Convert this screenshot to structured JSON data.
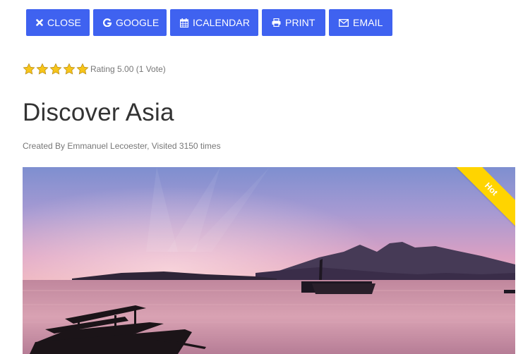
{
  "toolbar": {
    "close_label": "CLOSE",
    "google_label": "GOOGLE",
    "icalendar_label": "ICALENDAR",
    "print_label": "PRINT",
    "email_label": "EMAIL",
    "button_color": "#3f62f0"
  },
  "rating": {
    "stars_filled": 5,
    "stars_total": 5,
    "text": "Rating 5.00 (1 Vote)",
    "star_color": "#f7c51a"
  },
  "event": {
    "title": "Discover Asia",
    "meta": "Created By Emmanuel Lecoester, Visited 3150 times"
  },
  "hero": {
    "badge": "Hot",
    "badge_color": "#ffd400"
  }
}
